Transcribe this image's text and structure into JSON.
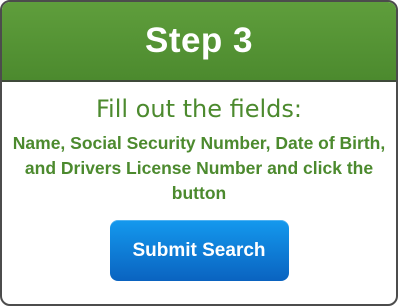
{
  "card": {
    "title": "Step 3",
    "subtitle": "Fill out the fields:",
    "instructions": "Name, Social Security Number, Date of Birth, and Drivers License Number and click the button",
    "button_label": "Submit Search"
  },
  "colors": {
    "header_green": "#4c8a2e",
    "text_green": "#4c8a2e",
    "button_blue": "#0a7fd8",
    "border": "#4c4c4c"
  }
}
